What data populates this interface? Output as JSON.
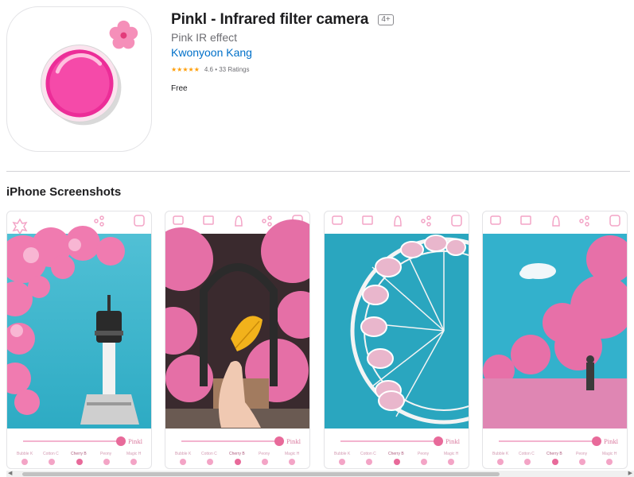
{
  "app": {
    "title": "Pinkl - Infrared filter camera",
    "age_rating": "4+",
    "subtitle": "Pink IR effect",
    "developer": "Kwonyoon Kang",
    "stars": "★★★★★",
    "rating_text": "4.6 • 33 Ratings",
    "price": "Free"
  },
  "section": {
    "title": "iPhone Screenshots"
  },
  "filters": [
    "Bubble K",
    "Cotton C",
    "Cherry B",
    "Peony",
    "Magic H"
  ],
  "screenshots": [
    {
      "subject": "tower"
    },
    {
      "subject": "leaf"
    },
    {
      "subject": "ferris-wheel"
    },
    {
      "subject": "pink-forest"
    }
  ],
  "colors": {
    "accent": "#0070c9",
    "pink": "#f06aa0",
    "sky": "#2bb0c9",
    "star": "#ff9f0a"
  }
}
